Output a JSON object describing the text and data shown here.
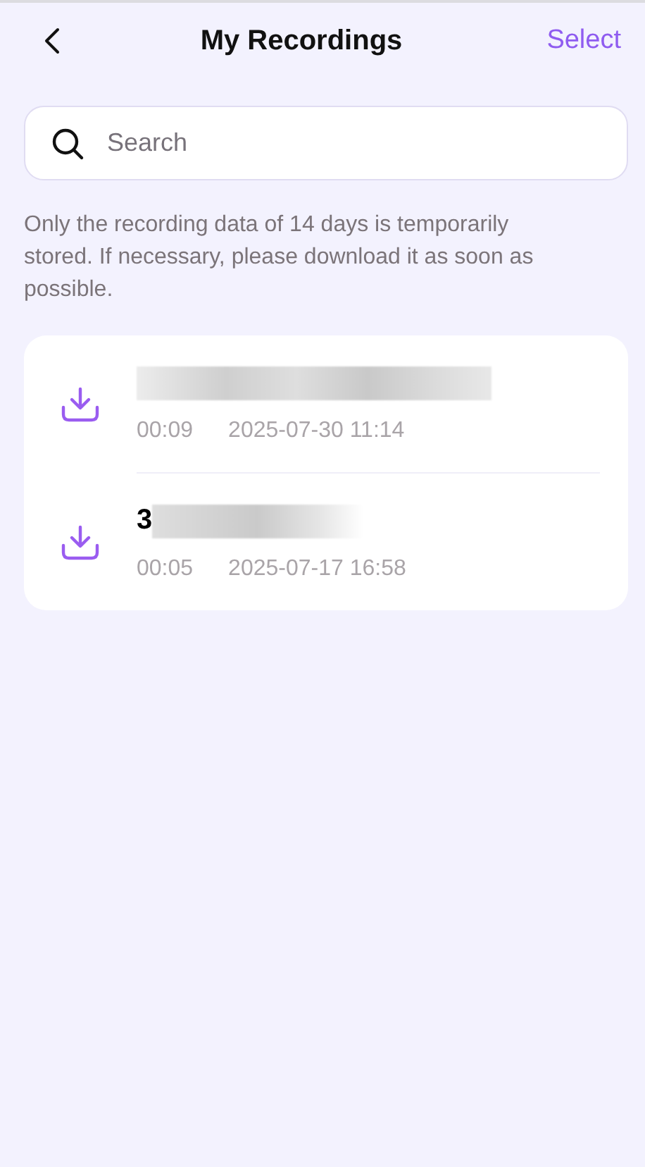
{
  "header": {
    "title": "My Recordings",
    "action": "Select"
  },
  "search": {
    "placeholder": "Search"
  },
  "notice": "Only the recording data of 14 days is temporarily stored. If necessary, please download it as soon as possible.",
  "recordings": [
    {
      "duration": "00:09",
      "date": "2025-07-30 11:14"
    },
    {
      "title_visible": "3",
      "duration": "00:05",
      "date": "2025-07-17 16:58"
    }
  ]
}
